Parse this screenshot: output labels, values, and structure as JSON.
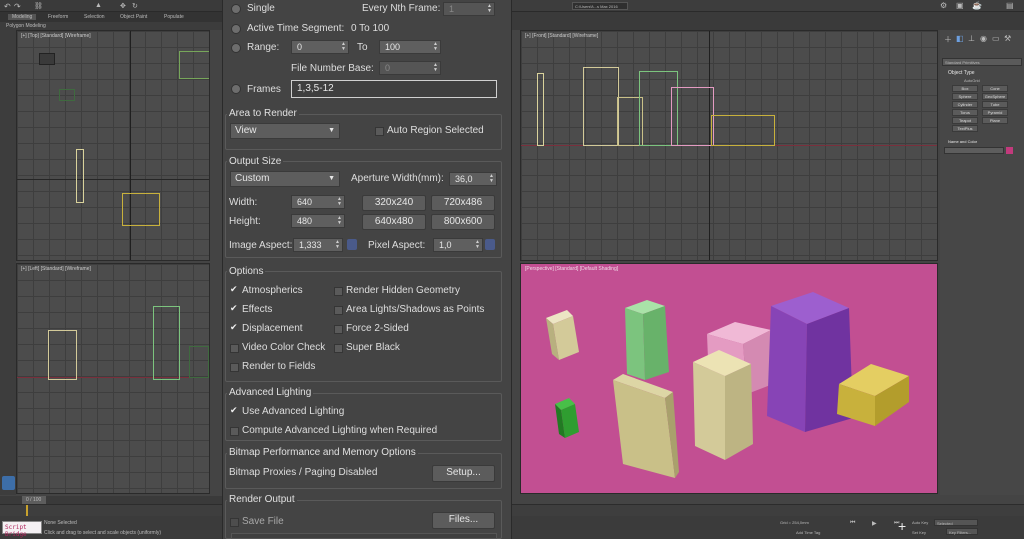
{
  "left_ui": {
    "tabs": [
      "Modeling",
      "Freeform",
      "Selection",
      "Object Paint",
      "Populate"
    ],
    "ribbon_label": "Polygon Modeling",
    "viewport_top_label": "[+] [Top] [Standard] [Wireframe]",
    "viewport_left_label": "[+] [Left] [Standard] [Wireframe]",
    "frame_counter": "0 / 100",
    "maxscript": "Script Bridge",
    "status_line1": "None Selected",
    "status_line2": "Click and drag to select and scale objects (uniformly)"
  },
  "dialog": {
    "time_output": {
      "single_label": "Single",
      "every_nth_label": "Every Nth Frame:",
      "every_nth_value": "1",
      "active_segment_label": "Active Time Segment:",
      "active_segment_value": "0 To 100",
      "range_label": "Range:",
      "range_from": "0",
      "range_to_label": "To",
      "range_to": "100",
      "file_number_base_label": "File Number Base:",
      "file_number_base_value": "0",
      "frames_label": "Frames",
      "frames_value": "1,3,5-12"
    },
    "area_to_render": {
      "title": "Area to Render",
      "dropdown": "View",
      "auto_region_label": "Auto Region Selected"
    },
    "output_size": {
      "title": "Output Size",
      "dropdown": "Custom",
      "aperture_label": "Aperture Width(mm):",
      "aperture_value": "36,0",
      "width_label": "Width:",
      "width_value": "640",
      "height_label": "Height:",
      "height_value": "480",
      "presets": [
        "320x240",
        "720x486",
        "640x480",
        "800x600"
      ],
      "image_aspect_label": "Image Aspect:",
      "image_aspect_value": "1,333",
      "pixel_aspect_label": "Pixel Aspect:",
      "pixel_aspect_value": "1,0"
    },
    "options": {
      "title": "Options",
      "left": [
        {
          "label": "Atmospherics",
          "checked": true
        },
        {
          "label": "Effects",
          "checked": true
        },
        {
          "label": "Displacement",
          "checked": true
        },
        {
          "label": "Video Color Check",
          "checked": false
        },
        {
          "label": "Render to Fields",
          "checked": false
        }
      ],
      "right": [
        {
          "label": "Render Hidden Geometry",
          "checked": false
        },
        {
          "label": "Area Lights/Shadows as Points",
          "checked": false
        },
        {
          "label": "Force 2-Sided",
          "checked": false
        },
        {
          "label": "Super Black",
          "checked": false
        }
      ]
    },
    "advanced_lighting": {
      "title": "Advanced Lighting",
      "use_label": "Use Advanced Lighting",
      "use_checked": true,
      "compute_label": "Compute Advanced Lighting when Required",
      "compute_checked": false
    },
    "bitmap": {
      "title": "Bitmap Performance and Memory Options",
      "status": "Bitmap Proxies / Paging Disabled",
      "setup_button": "Setup..."
    },
    "render_output": {
      "title": "Render Output",
      "save_file_label": "Save File",
      "files_button": "Files..."
    }
  },
  "right_ui": {
    "workspace_field": "C:\\Users\\l\\...s Max 2016",
    "viewport_front_label": "[+] [Front] [Standard] [Wireframe]",
    "viewport_persp_label": "[Perspective] [Standard] [Default Shading]",
    "command_panel": {
      "category": "Standard Primitives",
      "object_type_title": "Object Type",
      "autogrid": "AutoGrid",
      "objects": [
        "Box",
        "Cone",
        "Sphere",
        "GeoSphere",
        "Cylinder",
        "Tube",
        "Torus",
        "Pyramid",
        "Teapot",
        "Plane",
        "TextPlus"
      ],
      "name_color_title": "Name and Color"
    },
    "grid_readout": "Grid = 254,0mm",
    "add_time_tag": "Add Time Tag",
    "auto_key": "Auto Key",
    "set_key": "Set Key",
    "selected": "Selected",
    "key_filters": "Key Filters..."
  },
  "colors": {
    "perspective_bg": "#c24f92",
    "object_cream": "#d3ca99",
    "object_green": "#7cc47e",
    "object_pink": "#e49bc2",
    "object_purple": "#8744b6",
    "object_yellow": "#c8b13c",
    "object_small_green": "#2f9d30",
    "object_panel_tan": "#c9c088"
  }
}
